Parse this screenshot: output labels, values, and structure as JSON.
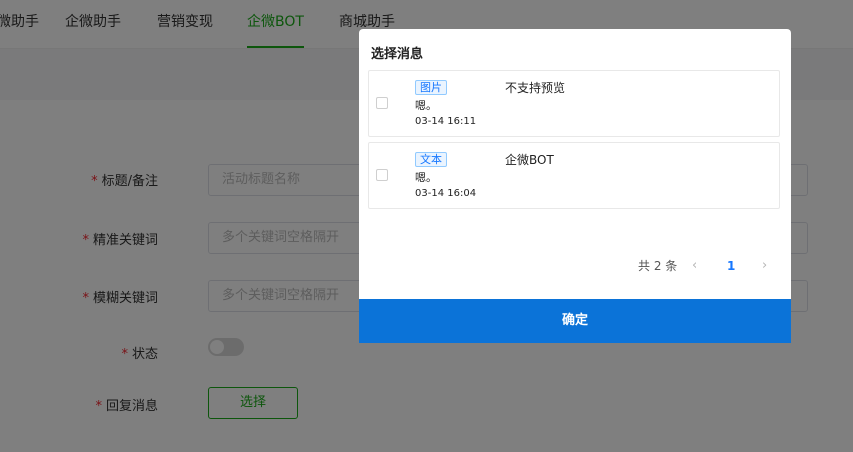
{
  "nav": {
    "tabs": [
      {
        "label": "微助手"
      },
      {
        "label": "企微助手"
      },
      {
        "label": "营销变现"
      },
      {
        "label": "企微BOT"
      },
      {
        "label": "商城助手"
      }
    ],
    "active_tab": "企微BOT"
  },
  "form": {
    "title_label": "标题/备注",
    "title_placeholder": "活动标题名称",
    "exact_keyword_label": "精准关键词",
    "exact_keyword_placeholder": "多个关键词空格隔开",
    "fuzzy_keyword_label": "模糊关键词",
    "fuzzy_keyword_placeholder": "多个关键词空格隔开",
    "status_label": "状态",
    "status_on": false,
    "reply_label": "回复消息",
    "select_button": "选择",
    "required_mark": "*"
  },
  "modal": {
    "title": "选择消息",
    "messages": [
      {
        "tag": "图片",
        "text": "嗯。",
        "time": "03-14 16:11",
        "preview": "不支持预览",
        "checked": false
      },
      {
        "tag": "文本",
        "text": "嗯。",
        "time": "03-14 16:04",
        "preview": "企微BOT",
        "checked": false
      }
    ],
    "pagination": {
      "total_text": "共 2 条",
      "prev": "‹",
      "current_page": "1",
      "next": "›"
    },
    "confirm_label": "确定"
  },
  "colors": {
    "accent_green": "#1aad19",
    "primary_blue": "#0b73d8",
    "tag_blue": "#1677ff",
    "required_red": "#f5222d"
  }
}
